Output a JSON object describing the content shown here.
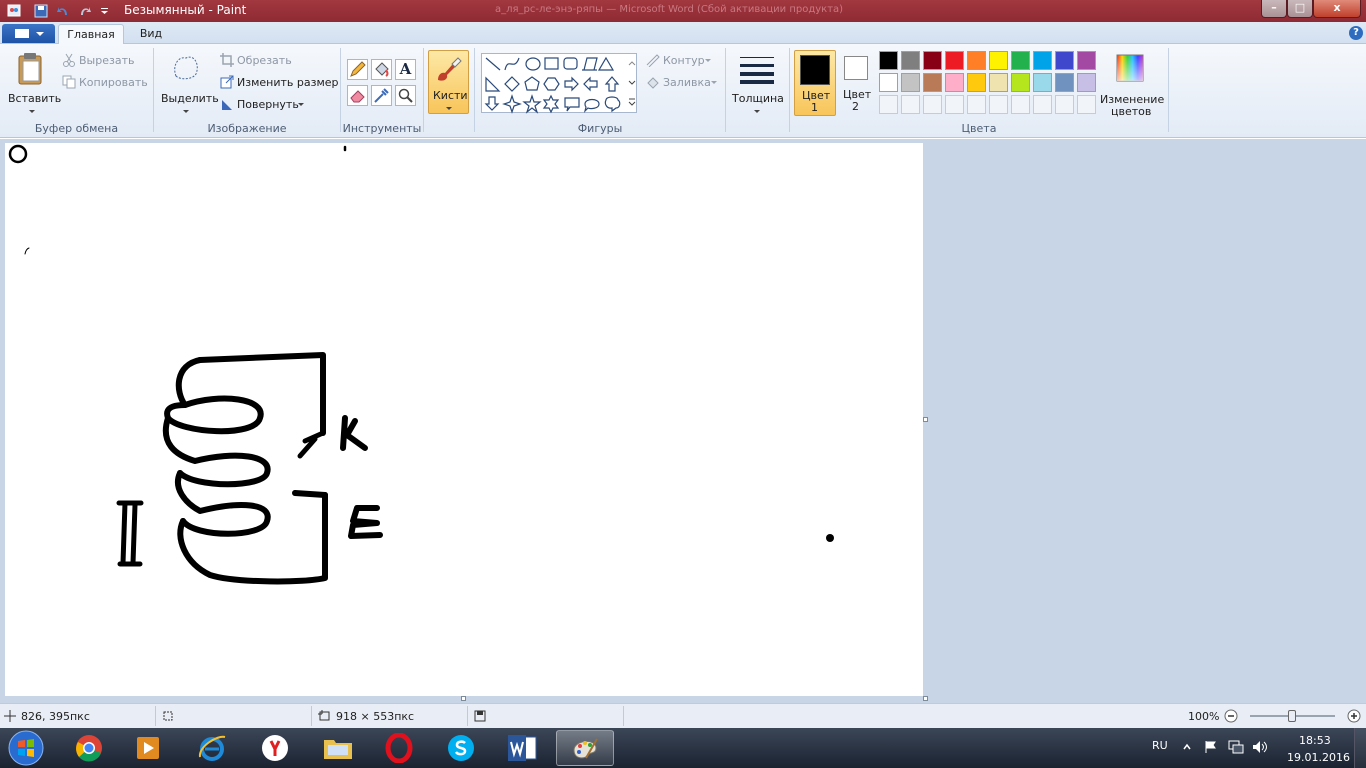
{
  "window": {
    "title": "Безымянный - Paint",
    "ghost_title": "а_ля_рс-ле-энэ-ряпы — Microsoft Word (Сбой активации продукта)",
    "controls": {
      "minimize": "–",
      "maximize": "□",
      "close": "x"
    }
  },
  "tabs": {
    "home": "Главная",
    "view": "Вид",
    "help": "?"
  },
  "clipboard": {
    "paste": "Вставить",
    "cut": "Вырезать",
    "copy": "Копировать",
    "group": "Буфер обмена"
  },
  "image": {
    "select": "Выделить",
    "crop": "Обрезать",
    "resize": "Изменить размер",
    "rotate": "Повернуть",
    "group": "Изображение"
  },
  "tools": {
    "group": "Инструменты",
    "text_glyph": "A"
  },
  "brushes": {
    "label": "Кисти"
  },
  "shapes": {
    "outline": "Контур",
    "fill": "Заливка",
    "group": "Фигуры"
  },
  "size": {
    "label": "Толщина"
  },
  "colors": {
    "color1": "Цвет",
    "color1_num": "1",
    "color2": "Цвет",
    "color2_num": "2",
    "edit1": "Изменение",
    "edit2": "цветов",
    "group": "Цвета",
    "color1_value": "#000000",
    "color2_value": "#ffffff",
    "palette_row1": [
      "#000000",
      "#7f7f7f",
      "#880015",
      "#ed1c24",
      "#ff7f27",
      "#fff200",
      "#22b14c",
      "#00a2e8",
      "#3f48cc",
      "#a349a4"
    ],
    "palette_row2": [
      "#ffffff",
      "#c3c3c3",
      "#b97a57",
      "#ffaec9",
      "#ffc90e",
      "#efe4b0",
      "#b5e61d",
      "#99d9ea",
      "#7092be",
      "#c8bfe7"
    ]
  },
  "status": {
    "cursor": "826, 395пкс",
    "size": "918 × 553пкс",
    "zoom": "100%"
  },
  "taskbar": {
    "lang": "RU",
    "time": "18:53",
    "date": "19.01.2016"
  }
}
